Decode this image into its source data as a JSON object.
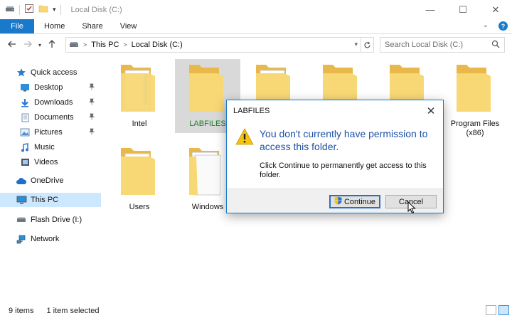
{
  "window": {
    "title": "Local Disk (C:)",
    "controls": {
      "minimize": "—",
      "maximize": "☐",
      "close": "✕"
    }
  },
  "ribbon": {
    "tabs": [
      "File",
      "Home",
      "Share",
      "View"
    ],
    "collapse_glyph": "⌄",
    "help_glyph": "?"
  },
  "address_bar": {
    "breadcrumbs": [
      "This PC",
      "Local Disk (C:)"
    ],
    "separator": ">",
    "search_placeholder": "Search Local Disk (C:)"
  },
  "nav_pane": {
    "items": [
      {
        "label": "Quick access",
        "icon": "star-icon",
        "level": 0
      },
      {
        "label": "Desktop",
        "icon": "desktop-icon",
        "level": 1,
        "pinned": true
      },
      {
        "label": "Downloads",
        "icon": "download-icon",
        "level": 1,
        "pinned": true
      },
      {
        "label": "Documents",
        "icon": "documents-icon",
        "level": 1,
        "pinned": true
      },
      {
        "label": "Pictures",
        "icon": "pictures-icon",
        "level": 1,
        "pinned": true
      },
      {
        "label": "Music",
        "icon": "music-icon",
        "level": 1
      },
      {
        "label": "Videos",
        "icon": "videos-icon",
        "level": 1
      },
      {
        "label": "OneDrive",
        "icon": "cloud-icon",
        "level": 0
      },
      {
        "label": "This PC",
        "icon": "computer-icon",
        "level": 0,
        "selected": true
      },
      {
        "label": "Flash Drive (I:)",
        "icon": "usb-drive-icon",
        "level": 0
      },
      {
        "label": "Network",
        "icon": "network-icon",
        "level": 0
      }
    ]
  },
  "folders": [
    {
      "name": "Intel",
      "type": "docs"
    },
    {
      "name": "LABFILES",
      "type": "plain",
      "selected": true
    },
    {
      "name": "",
      "type": "docs"
    },
    {
      "name": "",
      "type": "plain"
    },
    {
      "name": "",
      "type": "plain"
    },
    {
      "name": "Program Files (x86)",
      "type": "plain"
    },
    {
      "name": "Users",
      "type": "docs"
    },
    {
      "name": "Windows",
      "type": "white"
    }
  ],
  "status_bar": {
    "item_count": "9 items",
    "selection": "1 item selected"
  },
  "dialog": {
    "title": "LABFILES",
    "message": "You don't currently have permission to access this folder.",
    "detail": "Click Continue to permanently get access to this folder.",
    "continue_label": "Continue",
    "cancel_label": "Cancel",
    "close_glyph": "✕"
  },
  "colors": {
    "accent": "#1979ca",
    "selection": "#cce8ff",
    "dialog_heading": "#1d52a5",
    "selected_folder_label": "#1a7f2a",
    "folder": "#f8d775"
  }
}
